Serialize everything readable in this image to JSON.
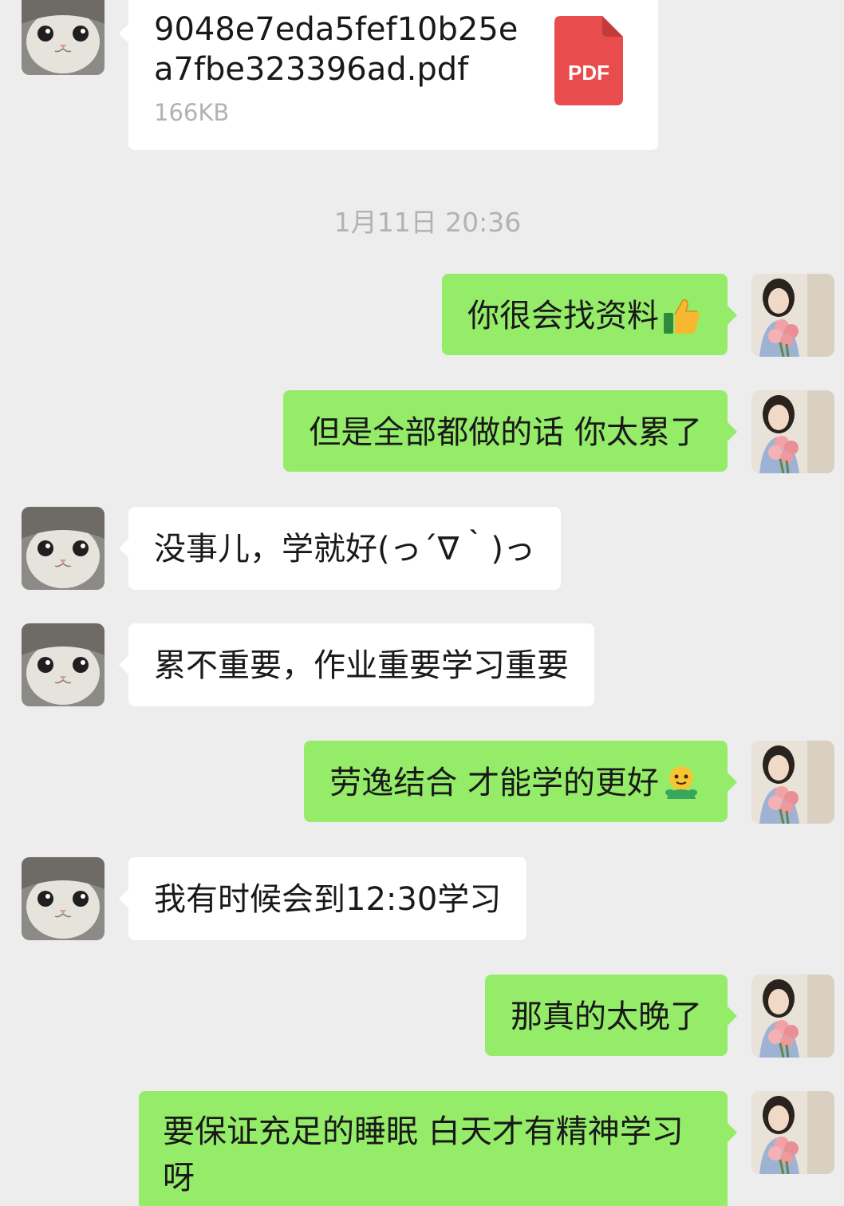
{
  "file_message": {
    "file_name": "9048e7eda5fef10b25ea7fbe323396ad.pdf",
    "file_size": "166KB",
    "file_type_label": "PDF",
    "icon": "pdf-file-icon",
    "icon_color": "#e84c4c"
  },
  "timestamp": "1月11日 20:36",
  "messages": [
    {
      "side": "out",
      "text": "你很会找资料",
      "emoji": "thumbs-up-emoji"
    },
    {
      "side": "out",
      "text": "但是全部都做的话 你太累了"
    },
    {
      "side": "in",
      "text": "没事儿，学就好(っ´∇｀)っ"
    },
    {
      "side": "in",
      "text": "累不重要，作业重要学习重要"
    },
    {
      "side": "out",
      "text": "劳逸结合 才能学的更好",
      "emoji": "hug-emoji"
    },
    {
      "side": "in",
      "text": "我有时候会到12:30学习"
    },
    {
      "side": "out",
      "text": "那真的太晚了"
    },
    {
      "side": "out",
      "text": "要保证充足的睡眠  白天才有精神学习呀"
    }
  ],
  "colors": {
    "background": "#ededed",
    "incoming_bubble": "#ffffff",
    "outgoing_bubble": "#95ec69",
    "timestamp_text": "#b2b2b2"
  },
  "avatars": {
    "contact": "cat-avatar",
    "self": "girl-with-flowers-avatar"
  }
}
